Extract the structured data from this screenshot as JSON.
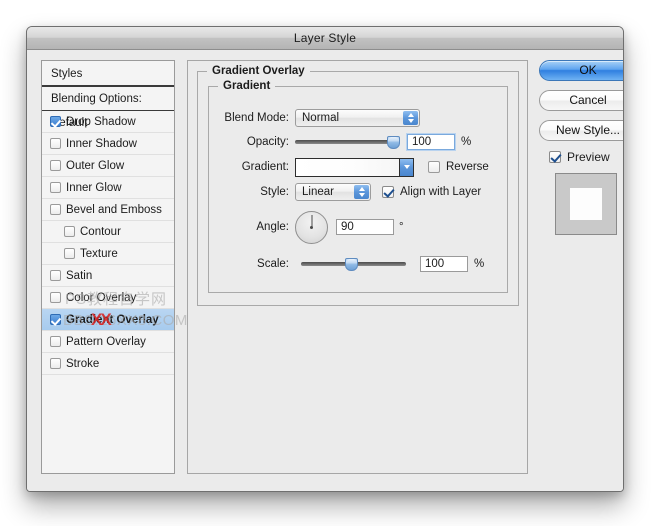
{
  "window": {
    "title": "Layer Style"
  },
  "styles_panel": {
    "header": "Styles",
    "blending_options": "Blending Options: Default",
    "items": [
      {
        "label": "Drop Shadow",
        "checked": true,
        "indent": false,
        "selected": false
      },
      {
        "label": "Inner Shadow",
        "checked": false,
        "indent": false,
        "selected": false
      },
      {
        "label": "Outer Glow",
        "checked": false,
        "indent": false,
        "selected": false
      },
      {
        "label": "Inner Glow",
        "checked": false,
        "indent": false,
        "selected": false
      },
      {
        "label": "Bevel and Emboss",
        "checked": false,
        "indent": false,
        "selected": false
      },
      {
        "label": "Contour",
        "checked": false,
        "indent": true,
        "selected": false
      },
      {
        "label": "Texture",
        "checked": false,
        "indent": true,
        "selected": false
      },
      {
        "label": "Satin",
        "checked": false,
        "indent": false,
        "selected": false
      },
      {
        "label": "Color Overlay",
        "checked": false,
        "indent": false,
        "selected": false
      },
      {
        "label": "Gradient Overlay",
        "checked": true,
        "indent": false,
        "selected": true
      },
      {
        "label": "Pattern Overlay",
        "checked": false,
        "indent": false,
        "selected": false
      },
      {
        "label": "Stroke",
        "checked": false,
        "indent": false,
        "selected": false
      }
    ]
  },
  "main_panel": {
    "group_title": "Gradient Overlay",
    "subgroup_title": "Gradient",
    "blend_mode": {
      "label": "Blend Mode:",
      "value": "Normal"
    },
    "opacity": {
      "label": "Opacity:",
      "value": "100",
      "unit": "%",
      "percent": 100
    },
    "gradient": {
      "label": "Gradient:",
      "reverse_label": "Reverse",
      "reverse_checked": false
    },
    "style": {
      "label": "Style:",
      "value": "Linear",
      "align_label": "Align with Layer",
      "align_checked": true
    },
    "angle": {
      "label": "Angle:",
      "value": "90",
      "unit": "°",
      "degrees": 90
    },
    "scale": {
      "label": "Scale:",
      "value": "100",
      "unit": "%",
      "percent": 48
    }
  },
  "buttons": {
    "ok": "OK",
    "cancel": "Cancel",
    "new_style": "New Style...",
    "preview_label": "Preview",
    "preview_checked": true
  },
  "watermark": {
    "line1": "PS教程自学网",
    "line2": "BBS.16XX8.COM",
    "mark": "XX"
  },
  "colors": {
    "accent_blue": "#3d7fd1",
    "dialog_bg": "#ebebeb",
    "selection_blue": "#a7cbee",
    "watermark_red": "#d62626"
  }
}
